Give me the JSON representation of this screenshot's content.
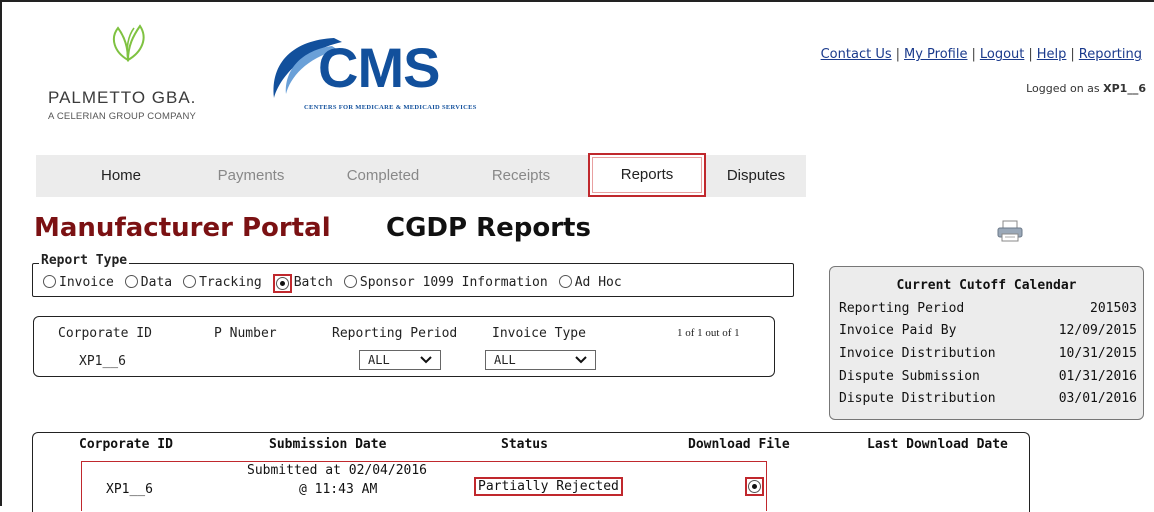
{
  "logos": {
    "palmetto_name": "PALMETTO GBA.",
    "palmetto_sub": "A CELERIAN GROUP COMPANY",
    "cms_letters": "CMS",
    "cms_tag": "CENTERS FOR MEDICARE & MEDICAID SERVICES"
  },
  "top_links": [
    "Contact Us",
    "My Profile",
    "Logout",
    "Help",
    "Reporting"
  ],
  "logged_on": {
    "prefix": "Logged on as",
    "user": "XP1__6"
  },
  "nav": {
    "tabs": [
      {
        "label": "Home",
        "state": "normal"
      },
      {
        "label": "Payments",
        "state": "dim"
      },
      {
        "label": "Completed",
        "state": "dim"
      },
      {
        "label": "Receipts",
        "state": "dim"
      },
      {
        "label": "Reports",
        "state": "active"
      },
      {
        "label": "Disputes",
        "state": "normal"
      }
    ]
  },
  "page": {
    "title": "Manufacturer Portal",
    "subtitle": "CGDP Reports"
  },
  "report_type": {
    "legend": "Report Type",
    "options": [
      "Invoice",
      "Data",
      "Tracking",
      "Batch",
      "Sponsor 1099 Information",
      "Ad Hoc"
    ],
    "selected": "Batch"
  },
  "filter": {
    "headers": {
      "corporate_id": "Corporate ID",
      "p_number": "P Number",
      "reporting_period": "Reporting Period",
      "invoice_type": "Invoice Type"
    },
    "corporate_id_value": "XP1__6",
    "reporting_period_selected": "ALL",
    "invoice_type_selected": "ALL",
    "pagination": "1 of 1 out of 1"
  },
  "calendar": {
    "title": "Current Cutoff Calendar",
    "rows": [
      {
        "label": "Reporting Period",
        "value": "201503"
      },
      {
        "label": "Invoice Paid By",
        "value": "12/09/2015"
      },
      {
        "label": "Invoice Distribution",
        "value": "10/31/2015"
      },
      {
        "label": "Dispute Submission",
        "value": "01/31/2016"
      },
      {
        "label": "Dispute Distribution",
        "value": "03/01/2016"
      }
    ]
  },
  "results": {
    "headers": {
      "corporate_id": "Corporate ID",
      "submission_date": "Submission Date",
      "status": "Status",
      "download_file": "Download File",
      "last_download": "Last Download Date"
    },
    "rows": [
      {
        "corporate_id": "XP1__6",
        "submission_line1": "Submitted at 02/04/2016",
        "submission_line2": "@ 11:43 AM",
        "status": "Partially Rejected",
        "download_selected": true,
        "last_download": ""
      }
    ]
  },
  "colors": {
    "brand_maroon": "#7b1113",
    "cms_blue": "#12509c",
    "highlight_red": "#c0282d",
    "link_blue": "#1a3a8c"
  }
}
